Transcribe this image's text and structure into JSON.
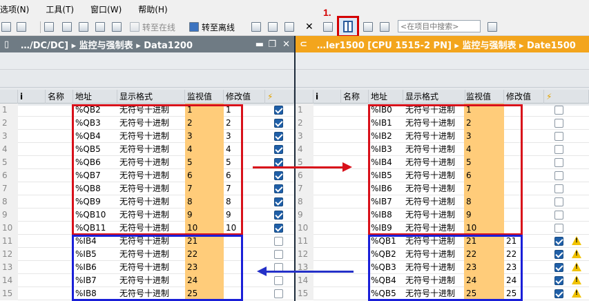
{
  "menubar": {
    "items": [
      "选项(N)",
      "工具(T)",
      "窗口(W)",
      "帮助(H)"
    ]
  },
  "toolbar": {
    "go_online": "转至在线",
    "go_offline": "转至离线",
    "search_placeholder": "<在项目中搜索>"
  },
  "annotation": {
    "step": "1."
  },
  "left_pane": {
    "title": "…/DC/DC] ▸ 监控与强制表 ▸ Data1200",
    "columns": [
      "",
      "i",
      "名称",
      "地址",
      "显示格式",
      "监视值",
      "修改值",
      "⚡"
    ],
    "rows": [
      {
        "n": "1",
        "addr": "%QB2",
        "fmt": "无符号十进制",
        "mon": "1",
        "mod": "1",
        "chk": true
      },
      {
        "n": "2",
        "addr": "%QB3",
        "fmt": "无符号十进制",
        "mon": "2",
        "mod": "2",
        "chk": true
      },
      {
        "n": "3",
        "addr": "%QB4",
        "fmt": "无符号十进制",
        "mon": "3",
        "mod": "3",
        "chk": true
      },
      {
        "n": "4",
        "addr": "%QB5",
        "fmt": "无符号十进制",
        "mon": "4",
        "mod": "4",
        "chk": true
      },
      {
        "n": "5",
        "addr": "%QB6",
        "fmt": "无符号十进制",
        "mon": "5",
        "mod": "5",
        "chk": true
      },
      {
        "n": "6",
        "addr": "%QB7",
        "fmt": "无符号十进制",
        "mon": "6",
        "mod": "6",
        "chk": true
      },
      {
        "n": "7",
        "addr": "%QB8",
        "fmt": "无符号十进制",
        "mon": "7",
        "mod": "7",
        "chk": true
      },
      {
        "n": "8",
        "addr": "%QB9",
        "fmt": "无符号十进制",
        "mon": "8",
        "mod": "8",
        "chk": true
      },
      {
        "n": "9",
        "addr": "%QB10",
        "fmt": "无符号十进制",
        "mon": "9",
        "mod": "9",
        "chk": true
      },
      {
        "n": "10",
        "addr": "%QB11",
        "fmt": "无符号十进制",
        "mon": "10",
        "mod": "10",
        "chk": true
      },
      {
        "n": "11",
        "addr": "%IB4",
        "fmt": "无符号十进制",
        "mon": "21",
        "mod": "",
        "chk": false
      },
      {
        "n": "12",
        "addr": "%IB5",
        "fmt": "无符号十进制",
        "mon": "22",
        "mod": "",
        "chk": false
      },
      {
        "n": "13",
        "addr": "%IB6",
        "fmt": "无符号十进制",
        "mon": "23",
        "mod": "",
        "chk": false
      },
      {
        "n": "14",
        "addr": "%IB7",
        "fmt": "无符号十进制",
        "mon": "24",
        "mod": "",
        "chk": false
      },
      {
        "n": "15",
        "addr": "%IB8",
        "fmt": "无符号十进制",
        "mon": "25",
        "mod": "",
        "chk": false
      }
    ]
  },
  "right_pane": {
    "title": "…ler1500 [CPU 1515-2 PN] ▸ 监控与强制表 ▸ Date1500",
    "columns": [
      "",
      "i",
      "名称",
      "地址",
      "显示格式",
      "监视值",
      "修改值",
      "⚡"
    ],
    "rows": [
      {
        "n": "1",
        "addr": "%IB0",
        "fmt": "无符号十进制",
        "mon": "1",
        "mod": "",
        "chk": false,
        "warn": false
      },
      {
        "n": "2",
        "addr": "%IB1",
        "fmt": "无符号十进制",
        "mon": "2",
        "mod": "",
        "chk": false,
        "warn": false
      },
      {
        "n": "3",
        "addr": "%IB2",
        "fmt": "无符号十进制",
        "mon": "3",
        "mod": "",
        "chk": false,
        "warn": false
      },
      {
        "n": "4",
        "addr": "%IB3",
        "fmt": "无符号十进制",
        "mon": "4",
        "mod": "",
        "chk": false,
        "warn": false
      },
      {
        "n": "5",
        "addr": "%IB4",
        "fmt": "无符号十进制",
        "mon": "5",
        "mod": "",
        "chk": false,
        "warn": false
      },
      {
        "n": "6",
        "addr": "%IB5",
        "fmt": "无符号十进制",
        "mon": "6",
        "mod": "",
        "chk": false,
        "warn": false
      },
      {
        "n": "7",
        "addr": "%IB6",
        "fmt": "无符号十进制",
        "mon": "7",
        "mod": "",
        "chk": false,
        "warn": false
      },
      {
        "n": "8",
        "addr": "%IB7",
        "fmt": "无符号十进制",
        "mon": "8",
        "mod": "",
        "chk": false,
        "warn": false
      },
      {
        "n": "9",
        "addr": "%IB8",
        "fmt": "无符号十进制",
        "mon": "9",
        "mod": "",
        "chk": false,
        "warn": false
      },
      {
        "n": "10",
        "addr": "%IB9",
        "fmt": "无符号十进制",
        "mon": "10",
        "mod": "",
        "chk": false,
        "warn": false
      },
      {
        "n": "11",
        "addr": "%QB1",
        "fmt": "无符号十进制",
        "mon": "21",
        "mod": "21",
        "chk": true,
        "warn": true
      },
      {
        "n": "12",
        "addr": "%QB2",
        "fmt": "无符号十进制",
        "mon": "22",
        "mod": "22",
        "chk": true,
        "warn": true
      },
      {
        "n": "13",
        "addr": "%QB3",
        "fmt": "无符号十进制",
        "mon": "23",
        "mod": "23",
        "chk": true,
        "warn": true
      },
      {
        "n": "14",
        "addr": "%QB4",
        "fmt": "无符号十进制",
        "mon": "24",
        "mod": "24",
        "chk": true,
        "warn": true
      },
      {
        "n": "15",
        "addr": "%QB5",
        "fmt": "无符号十进制",
        "mon": "25",
        "mod": "25",
        "chk": true,
        "warn": true
      }
    ]
  },
  "colors": {
    "highlight_red": "#d8101a",
    "highlight_blue": "#1a1fd8",
    "monitor_fill": "#ffcc7a",
    "left_title": "#6f7b84",
    "right_title": "#f3a51d"
  }
}
